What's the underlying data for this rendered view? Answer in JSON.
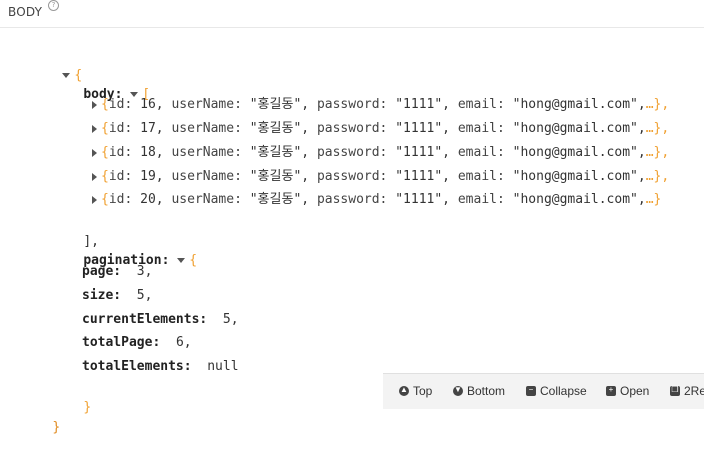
{
  "header": {
    "title": "BODY",
    "help": "?"
  },
  "json": {
    "root_open": "{",
    "root_close": "}",
    "body_key": "body:",
    "body_open": "[",
    "body_close": "],",
    "rows": [
      {
        "open": "{",
        "id_key": "id:",
        "id": "16,",
        "name_key": "userName:",
        "name": "\"홍길동\",",
        "pw_key": "password:",
        "pw": "\"1111\",",
        "email_key": "email:",
        "email": "\"hong@gmail.com\",",
        "ellipsis": "…",
        "close": "},"
      },
      {
        "open": "{",
        "id_key": "id:",
        "id": "17,",
        "name_key": "userName:",
        "name": "\"홍길동\",",
        "pw_key": "password:",
        "pw": "\"1111\",",
        "email_key": "email:",
        "email": "\"hong@gmail.com\",",
        "ellipsis": "…",
        "close": "},"
      },
      {
        "open": "{",
        "id_key": "id:",
        "id": "18,",
        "name_key": "userName:",
        "name": "\"홍길동\",",
        "pw_key": "password:",
        "pw": "\"1111\",",
        "email_key": "email:",
        "email": "\"hong@gmail.com\",",
        "ellipsis": "…",
        "close": "},"
      },
      {
        "open": "{",
        "id_key": "id:",
        "id": "19,",
        "name_key": "userName:",
        "name": "\"홍길동\",",
        "pw_key": "password:",
        "pw": "\"1111\",",
        "email_key": "email:",
        "email": "\"hong@gmail.com\",",
        "ellipsis": "…",
        "close": "},"
      },
      {
        "open": "{",
        "id_key": "id:",
        "id": "20,",
        "name_key": "userName:",
        "name": "\"홍길동\",",
        "pw_key": "password:",
        "pw": "\"1111\",",
        "email_key": "email:",
        "email": "\"hong@gmail.com\",",
        "ellipsis": "…",
        "close": "}"
      }
    ],
    "pagination_key": "pagination:",
    "pagination_open": "{",
    "pagination_close": "}",
    "pagination": [
      {
        "key": "page:",
        "value": "3,"
      },
      {
        "key": "size:",
        "value": "5,"
      },
      {
        "key": "currentElements:",
        "value": "5,"
      },
      {
        "key": "totalPage:",
        "value": "6,"
      },
      {
        "key": "totalElements:",
        "value": "null"
      }
    ]
  },
  "toolbar": {
    "top": "Top",
    "bottom": "Bottom",
    "collapse": "Collapse",
    "open": "Open",
    "raw": "2Re"
  },
  "icons": {
    "top": "arrow-up-circle-icon",
    "bottom": "arrow-down-circle-icon",
    "collapse": "minus-square-icon",
    "open": "plus-square-icon",
    "raw": "copy-icon"
  }
}
